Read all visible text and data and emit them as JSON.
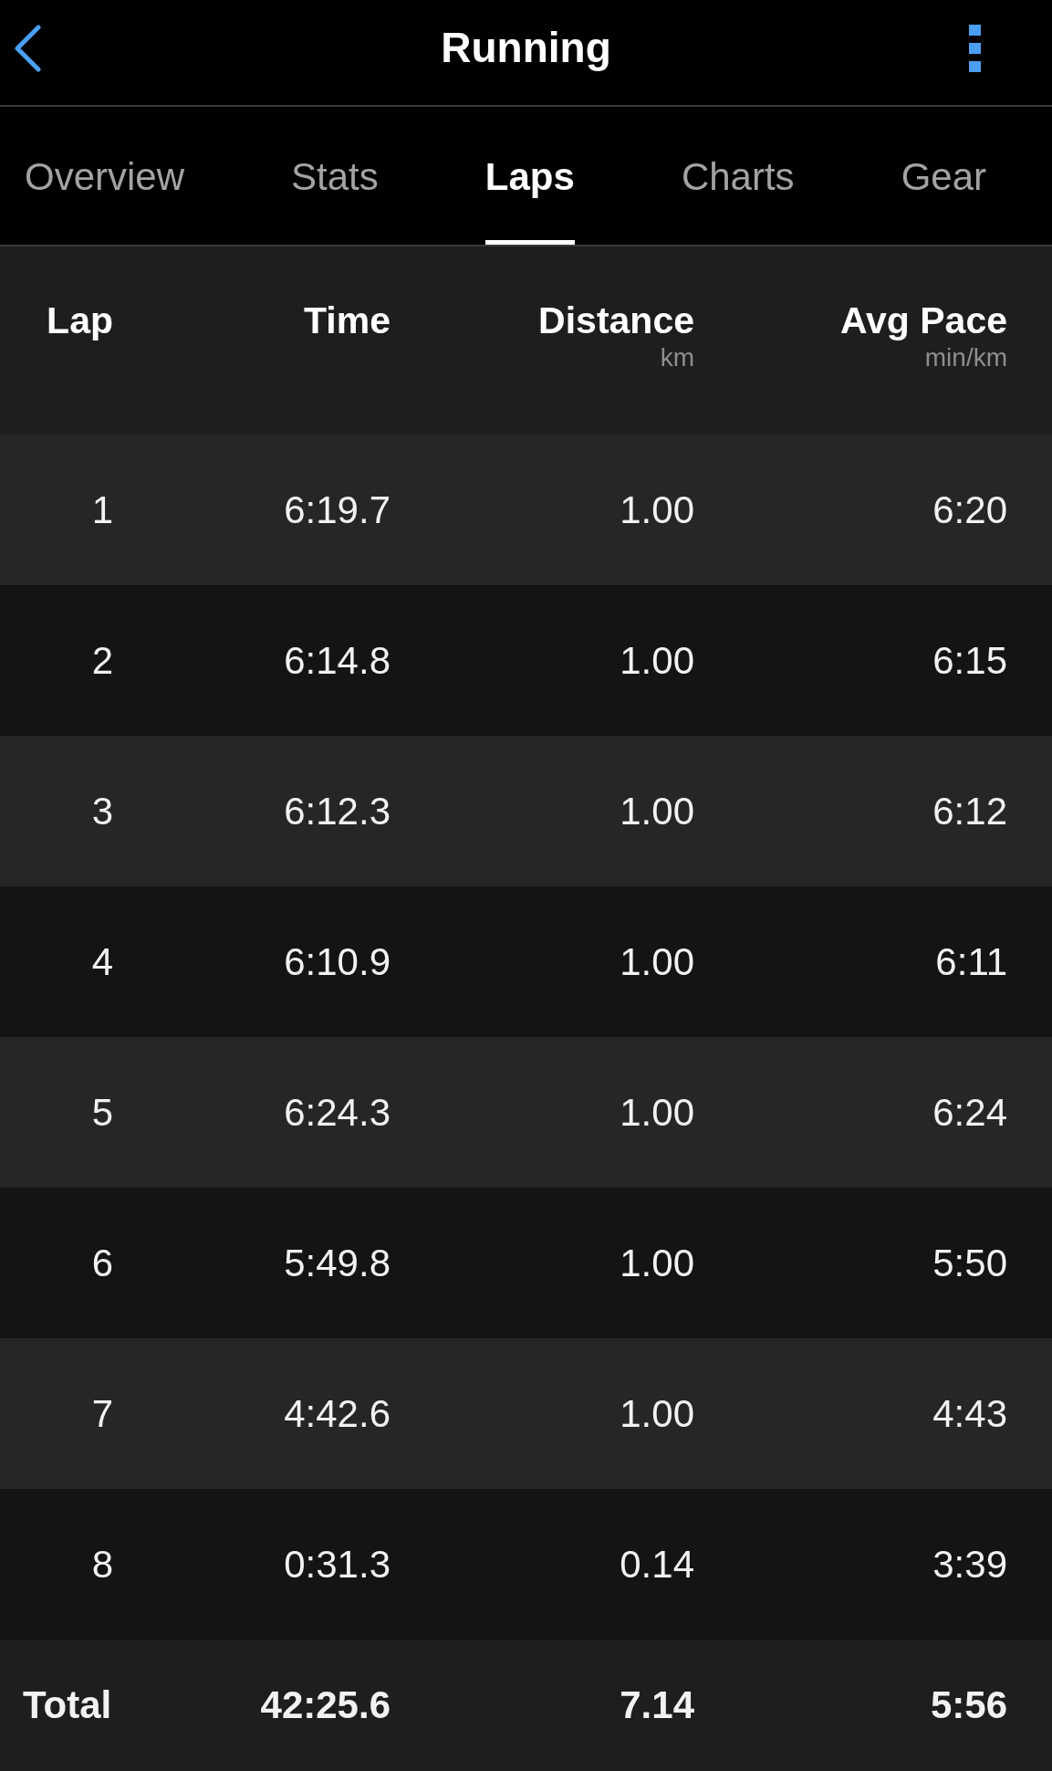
{
  "header": {
    "title": "Running"
  },
  "tabs": [
    {
      "label": "Overview",
      "selected": false
    },
    {
      "label": "Stats",
      "selected": false
    },
    {
      "label": "Laps",
      "selected": true
    },
    {
      "label": "Charts",
      "selected": false
    },
    {
      "label": "Gear",
      "selected": false
    }
  ],
  "table": {
    "columns": [
      {
        "label": "Lap"
      },
      {
        "label": "Time"
      },
      {
        "label": "Distance",
        "unit": "km"
      },
      {
        "label": "Avg Pace",
        "unit": "min/km"
      }
    ],
    "rows": [
      {
        "cells": [
          "1",
          "6:19.7",
          "1.00",
          "6:20"
        ]
      },
      {
        "cells": [
          "2",
          "6:14.8",
          "1.00",
          "6:15"
        ]
      },
      {
        "cells": [
          "3",
          "6:12.3",
          "1.00",
          "6:12"
        ]
      },
      {
        "cells": [
          "4",
          "6:10.9",
          "1.00",
          "6:11"
        ]
      },
      {
        "cells": [
          "5",
          "6:24.3",
          "1.00",
          "6:24"
        ]
      },
      {
        "cells": [
          "6",
          "5:49.8",
          "1.00",
          "5:50"
        ]
      },
      {
        "cells": [
          "7",
          "4:42.6",
          "1.00",
          "4:43"
        ]
      },
      {
        "cells": [
          "8",
          "0:31.3",
          "0.14",
          "3:39"
        ]
      }
    ],
    "total": {
      "cells": [
        "Total",
        "42:25.6",
        "7.14",
        "5:56"
      ]
    }
  }
}
